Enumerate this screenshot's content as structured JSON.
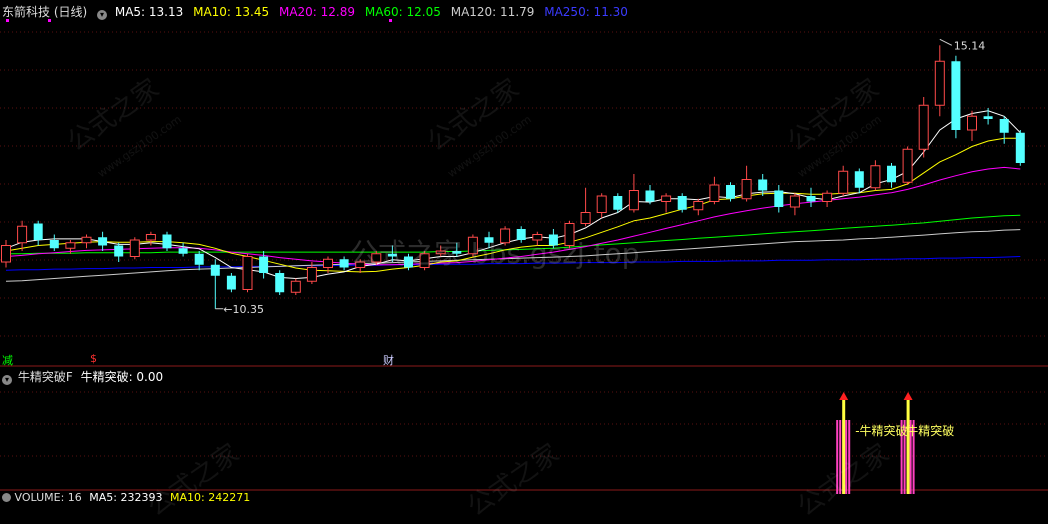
{
  "header": {
    "stock_name": "东箭科技 (日线)",
    "ma": [
      {
        "label": "MA5: 13.13",
        "color": "#ffffff"
      },
      {
        "label": "MA10: 13.45",
        "color": "#ffff00"
      },
      {
        "label": "MA20: 12.89",
        "color": "#ff00ff"
      },
      {
        "label": "MA60: 12.05",
        "color": "#00ff00"
      },
      {
        "label": "MA120: 11.79",
        "color": "#cccccc"
      },
      {
        "label": "MA250: 11.30",
        "color": "#0000ff"
      }
    ]
  },
  "main": {
    "high_label": "15.14",
    "low_label": "10.35",
    "markers": {
      "left": "减",
      "mid": "$",
      "right": "财"
    }
  },
  "indicator": {
    "name": "牛精突破F",
    "value_label": "牛精突破: 0.00",
    "signal_label": "牛精突破",
    "signal_label2": "牛精突破"
  },
  "volume": {
    "label": "VOLUME: 16",
    "ma5": "MA5: 232393",
    "ma10": "MA10: 242271"
  },
  "watermark": {
    "center": "公式之家 bbs.gszj.top",
    "brand": "公式之家",
    "site": "www.gszj100.com"
  },
  "chart_data": {
    "type": "candlestick",
    "ylim": [
      9.6,
      15.6
    ],
    "colors": {
      "up": "#ff4a4a",
      "down": "#54ffff",
      "ma5": "#ffffff",
      "ma10": "#ffff00",
      "ma20": "#ff00ff",
      "ma60": "#00ff00",
      "ma120": "#cccccc",
      "ma250": "#0000ff"
    },
    "candles": [
      [
        11.2,
        11.6,
        11.1,
        11.5
      ],
      [
        11.55,
        11.95,
        11.4,
        11.85
      ],
      [
        11.9,
        11.95,
        11.5,
        11.6
      ],
      [
        11.6,
        11.7,
        11.4,
        11.45
      ],
      [
        11.45,
        11.6,
        11.35,
        11.55
      ],
      [
        11.55,
        11.7,
        11.45,
        11.65
      ],
      [
        11.65,
        11.75,
        11.4,
        11.5
      ],
      [
        11.5,
        11.55,
        11.2,
        11.3
      ],
      [
        11.3,
        11.65,
        11.25,
        11.6
      ],
      [
        11.6,
        11.75,
        11.5,
        11.7
      ],
      [
        11.7,
        11.75,
        11.4,
        11.45
      ],
      [
        11.45,
        11.55,
        11.3,
        11.35
      ],
      [
        11.35,
        11.4,
        11.05,
        11.15
      ],
      [
        11.15,
        11.25,
        10.35,
        10.95
      ],
      [
        10.95,
        11.0,
        10.65,
        10.7
      ],
      [
        10.7,
        11.35,
        10.65,
        11.3
      ],
      [
        11.3,
        11.4,
        10.9,
        11.0
      ],
      [
        11.0,
        11.05,
        10.6,
        10.65
      ],
      [
        10.65,
        10.9,
        10.6,
        10.85
      ],
      [
        10.85,
        11.2,
        10.8,
        11.1
      ],
      [
        11.1,
        11.3,
        11.0,
        11.25
      ],
      [
        11.25,
        11.3,
        11.05,
        11.1
      ],
      [
        11.1,
        11.25,
        11.0,
        11.2
      ],
      [
        11.2,
        11.4,
        11.15,
        11.35
      ],
      [
        11.35,
        11.5,
        11.2,
        11.3
      ],
      [
        11.3,
        11.35,
        11.05,
        11.1
      ],
      [
        11.1,
        11.4,
        11.05,
        11.35
      ],
      [
        11.35,
        11.5,
        11.3,
        11.4
      ],
      [
        11.4,
        11.55,
        11.3,
        11.35
      ],
      [
        11.35,
        11.7,
        11.3,
        11.65
      ],
      [
        11.65,
        11.75,
        11.45,
        11.55
      ],
      [
        11.55,
        11.85,
        11.5,
        11.8
      ],
      [
        11.8,
        11.85,
        11.55,
        11.6
      ],
      [
        11.6,
        11.75,
        11.5,
        11.7
      ],
      [
        11.7,
        11.8,
        11.45,
        11.5
      ],
      [
        11.5,
        11.95,
        11.45,
        11.9
      ],
      [
        11.9,
        12.55,
        11.85,
        12.1
      ],
      [
        12.1,
        12.45,
        12.0,
        12.4
      ],
      [
        12.4,
        12.45,
        12.1,
        12.15
      ],
      [
        12.15,
        12.8,
        12.1,
        12.5
      ],
      [
        12.5,
        12.6,
        12.25,
        12.3
      ],
      [
        12.3,
        12.45,
        12.1,
        12.4
      ],
      [
        12.4,
        12.45,
        12.1,
        12.15
      ],
      [
        12.15,
        12.35,
        12.05,
        12.3
      ],
      [
        12.3,
        12.75,
        12.25,
        12.6
      ],
      [
        12.6,
        12.65,
        12.3,
        12.35
      ],
      [
        12.35,
        12.95,
        12.3,
        12.7
      ],
      [
        12.7,
        12.8,
        12.4,
        12.5
      ],
      [
        12.5,
        12.6,
        12.1,
        12.2
      ],
      [
        12.2,
        12.45,
        12.05,
        12.4
      ],
      [
        12.4,
        12.55,
        12.2,
        12.3
      ],
      [
        12.3,
        12.5,
        12.2,
        12.45
      ],
      [
        12.45,
        12.95,
        12.4,
        12.85
      ],
      [
        12.85,
        12.9,
        12.45,
        12.55
      ],
      [
        12.55,
        13.05,
        12.5,
        12.95
      ],
      [
        12.95,
        13.0,
        12.55,
        12.65
      ],
      [
        12.65,
        13.3,
        12.6,
        13.25
      ],
      [
        13.25,
        14.2,
        13.1,
        14.05
      ],
      [
        14.05,
        15.14,
        13.85,
        14.85
      ],
      [
        14.85,
        14.95,
        13.45,
        13.6
      ],
      [
        13.6,
        13.95,
        13.4,
        13.85
      ],
      [
        13.85,
        14.0,
        13.7,
        13.8
      ],
      [
        13.8,
        13.85,
        13.35,
        13.55
      ],
      [
        13.55,
        13.6,
        12.95,
        13.0
      ]
    ],
    "ma5": [
      11.45,
      11.56,
      11.6,
      11.62,
      11.62,
      11.62,
      11.57,
      11.52,
      11.52,
      11.55,
      11.52,
      11.48,
      11.44,
      11.28,
      11.1,
      11.06,
      11.02,
      10.92,
      10.9,
      10.92,
      10.98,
      11.02,
      11.12,
      11.16,
      11.24,
      11.22,
      11.26,
      11.3,
      11.3,
      11.37,
      11.46,
      11.55,
      11.62,
      11.66,
      11.63,
      11.7,
      11.82,
      12.0,
      12.1,
      12.3,
      12.29,
      12.35,
      12.35,
      12.33,
      12.39,
      12.37,
      12.44,
      12.47,
      12.48,
      12.44,
      12.37,
      12.33,
      12.4,
      12.46,
      12.62,
      12.7,
      12.85,
      13.2,
      13.6,
      13.8,
      13.9,
      13.95,
      13.85,
      13.55
    ],
    "ma10": [
      11.4,
      11.45,
      11.5,
      11.52,
      11.54,
      11.56,
      11.57,
      11.56,
      11.56,
      11.57,
      11.57,
      11.55,
      11.52,
      11.45,
      11.36,
      11.3,
      11.23,
      11.16,
      11.09,
      11.05,
      11.04,
      11.03,
      11.02,
      11.03,
      11.07,
      11.1,
      11.14,
      11.2,
      11.22,
      11.29,
      11.35,
      11.42,
      11.47,
      11.5,
      11.5,
      11.56,
      11.64,
      11.74,
      11.84,
      11.95,
      12.0,
      12.08,
      12.16,
      12.23,
      12.33,
      12.35,
      12.4,
      12.44,
      12.45,
      12.45,
      12.43,
      12.43,
      12.45,
      12.46,
      12.5,
      12.52,
      12.62,
      12.82,
      13.02,
      13.15,
      13.3,
      13.4,
      13.45,
      13.45
    ],
    "ma20": [
      11.3,
      11.32,
      11.35,
      11.37,
      11.39,
      11.41,
      11.42,
      11.43,
      11.44,
      11.45,
      11.46,
      11.46,
      11.45,
      11.42,
      11.38,
      11.35,
      11.32,
      11.28,
      11.25,
      11.22,
      11.2,
      11.18,
      11.16,
      11.15,
      11.15,
      11.16,
      11.17,
      11.18,
      11.19,
      11.21,
      11.24,
      11.27,
      11.3,
      11.34,
      11.38,
      11.43,
      11.48,
      11.54,
      11.6,
      11.67,
      11.74,
      11.81,
      11.88,
      11.95,
      12.02,
      12.08,
      12.13,
      12.18,
      12.22,
      12.26,
      12.29,
      12.32,
      12.35,
      12.38,
      12.42,
      12.46,
      12.52,
      12.6,
      12.69,
      12.77,
      12.84,
      12.89,
      12.92,
      12.89
    ],
    "ma60": [
      11.35,
      11.35,
      11.36,
      11.36,
      11.36,
      11.37,
      11.37,
      11.37,
      11.37,
      11.37,
      11.38,
      11.38,
      11.38,
      11.38,
      11.38,
      11.38,
      11.38,
      11.38,
      11.38,
      11.38,
      11.38,
      11.38,
      11.38,
      11.38,
      11.38,
      11.38,
      11.38,
      11.39,
      11.39,
      11.4,
      11.41,
      11.42,
      11.43,
      11.44,
      11.45,
      11.47,
      11.49,
      11.51,
      11.53,
      11.55,
      11.57,
      11.59,
      11.61,
      11.63,
      11.65,
      11.67,
      11.69,
      11.71,
      11.73,
      11.75,
      11.77,
      11.79,
      11.81,
      11.83,
      11.85,
      11.87,
      11.89,
      11.91,
      11.94,
      11.97,
      12.0,
      12.02,
      12.04,
      12.05
    ],
    "ma120": [
      10.85,
      10.86,
      10.88,
      10.9,
      10.92,
      10.94,
      10.96,
      10.98,
      11.0,
      11.02,
      11.04,
      11.06,
      11.07,
      11.08,
      11.09,
      11.1,
      11.11,
      11.12,
      11.13,
      11.14,
      11.15,
      11.16,
      11.17,
      11.18,
      11.19,
      11.2,
      11.21,
      11.22,
      11.23,
      11.24,
      11.25,
      11.26,
      11.27,
      11.28,
      11.29,
      11.3,
      11.31,
      11.33,
      11.35,
      11.37,
      11.39,
      11.41,
      11.43,
      11.45,
      11.47,
      11.49,
      11.51,
      11.53,
      11.55,
      11.57,
      11.58,
      11.59,
      11.6,
      11.62,
      11.63,
      11.65,
      11.67,
      11.69,
      11.71,
      11.73,
      11.75,
      11.76,
      11.78,
      11.79
    ],
    "ma250": [
      11.05,
      11.06,
      11.06,
      11.07,
      11.07,
      11.08,
      11.08,
      11.09,
      11.09,
      11.1,
      11.1,
      11.1,
      11.11,
      11.11,
      11.11,
      11.12,
      11.12,
      11.12,
      11.13,
      11.13,
      11.13,
      11.14,
      11.14,
      11.14,
      11.15,
      11.15,
      11.15,
      11.16,
      11.16,
      11.16,
      11.17,
      11.17,
      11.17,
      11.18,
      11.18,
      11.18,
      11.19,
      11.19,
      11.19,
      11.2,
      11.2,
      11.2,
      11.21,
      11.21,
      11.21,
      11.22,
      11.22,
      11.22,
      11.23,
      11.23,
      11.23,
      11.24,
      11.24,
      11.24,
      11.25,
      11.25,
      11.26,
      11.26,
      11.27,
      11.27,
      11.28,
      11.28,
      11.29,
      11.3
    ],
    "signals": [
      52,
      56
    ]
  }
}
